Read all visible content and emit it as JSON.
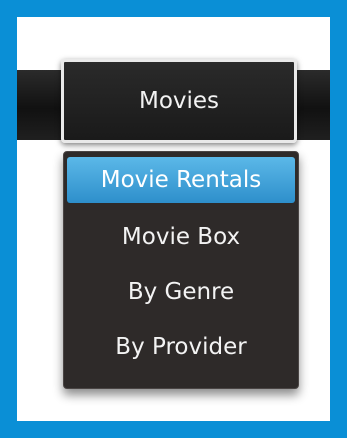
{
  "nav": {
    "selected_tab": "Movies"
  },
  "dropdown": {
    "items": [
      {
        "label": "Movie Rentals",
        "highlighted": true
      },
      {
        "label": "Movie Box",
        "highlighted": false
      },
      {
        "label": "By Genre",
        "highlighted": false
      },
      {
        "label": "By Provider",
        "highlighted": false
      }
    ]
  },
  "colors": {
    "frame_border": "#0a8fd6",
    "highlight": "#2e8fcb",
    "menu_bg": "#2e2a29"
  }
}
